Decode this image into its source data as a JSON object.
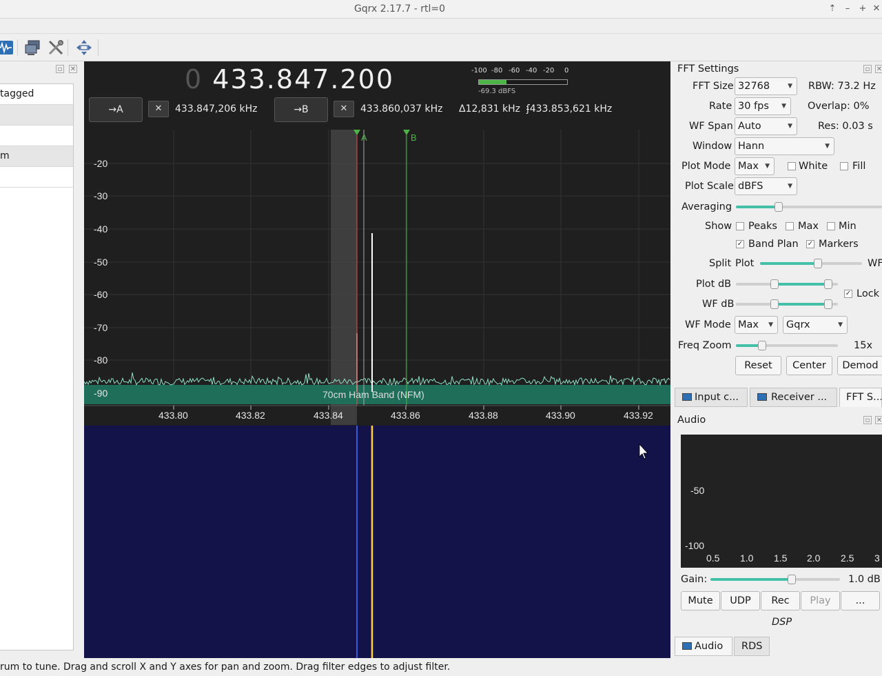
{
  "window": {
    "title": "Gqrx 2.17.7 - rtl=0"
  },
  "left_panel": {
    "items": [
      "tagged",
      "",
      "",
      "m",
      ""
    ]
  },
  "frequency": {
    "dim_digit": "0",
    "main": "433.847.200"
  },
  "vfo": {
    "a_button": "→A",
    "a_freq": "433.847,206 kHz",
    "b_button": "→B",
    "b_freq": "433.860,037 kHz",
    "delta": "Δ12,831 kHz",
    "center": "ʄ433.853,621 kHz",
    "clear": "✕"
  },
  "meter": {
    "scale": [
      "-100",
      "-80",
      "-60",
      "-40",
      "-20",
      "0"
    ],
    "label": "-69.3 dBFS",
    "level_fraction": 0.31
  },
  "plot": {
    "y_ticks": [
      "-20",
      "-30",
      "-40",
      "-50",
      "-60",
      "-70",
      "-80",
      "-90"
    ],
    "x_ticks": [
      "433.80",
      "433.82",
      "433.84",
      "433.86",
      "433.88",
      "433.90",
      "433.92"
    ],
    "marker_a": "A",
    "marker_b": "B",
    "band_label": "70cm Ham Band (NFM)"
  },
  "fft": {
    "title": "FFT Settings",
    "fft_size_label": "FFT Size",
    "fft_size": "32768",
    "rbw": "RBW: 73.2 Hz",
    "rate_label": "Rate",
    "rate": "30 fps",
    "overlap": "Overlap: 0%",
    "wf_span_label": "WF Span",
    "wf_span": "Auto",
    "res": "Res: 0.03 s",
    "window_label": "Window",
    "window": "Hann",
    "plot_mode_label": "Plot Mode",
    "plot_mode": "Max",
    "white": "White",
    "fill": "Fill",
    "plot_scale_label": "Plot Scale",
    "plot_scale": "dBFS",
    "averaging_label": "Averaging",
    "show_label": "Show",
    "peaks": "Peaks",
    "max": "Max",
    "min": "Min",
    "band_plan": "Band Plan",
    "markers": "Markers",
    "split_label": "Split",
    "split_plot": "Plot",
    "split_wf": "WF",
    "plot_db_label": "Plot dB",
    "wf_db_label": "WF dB",
    "lock": "Lock",
    "wf_mode_label": "WF Mode",
    "wf_mode": "Max",
    "wf_color": "Gqrx",
    "freq_zoom_label": "Freq Zoom",
    "freq_zoom": "15x",
    "reset": "Reset",
    "center": "Center",
    "demod": "Demod",
    "check_mark": "✓"
  },
  "tabs": {
    "input": "Input c...",
    "receiver": "Receiver ...",
    "fft": "FFT S..."
  },
  "audio": {
    "title": "Audio",
    "y_ticks": [
      "-50",
      "-100"
    ],
    "x_ticks": [
      "0.5",
      "1.0",
      "1.5",
      "2.0",
      "2.5",
      "3"
    ],
    "gain_label": "Gain:",
    "gain": "1.0 dB",
    "mute": "Mute",
    "udp": "UDP",
    "rec": "Rec",
    "play": "Play",
    "more": "...",
    "dsp": "DSP"
  },
  "bottom_tabs": {
    "audio": "Audio",
    "rds": "RDS"
  },
  "status": "rum to tune. Drag and scroll X and Y axes for pan and zoom. Drag filter edges to adjust filter.",
  "colors": {
    "accent": "#44c0a8",
    "spectrum_fill": "#1e6e5a",
    "waterfall": "#101040",
    "marker": "#4db545"
  }
}
